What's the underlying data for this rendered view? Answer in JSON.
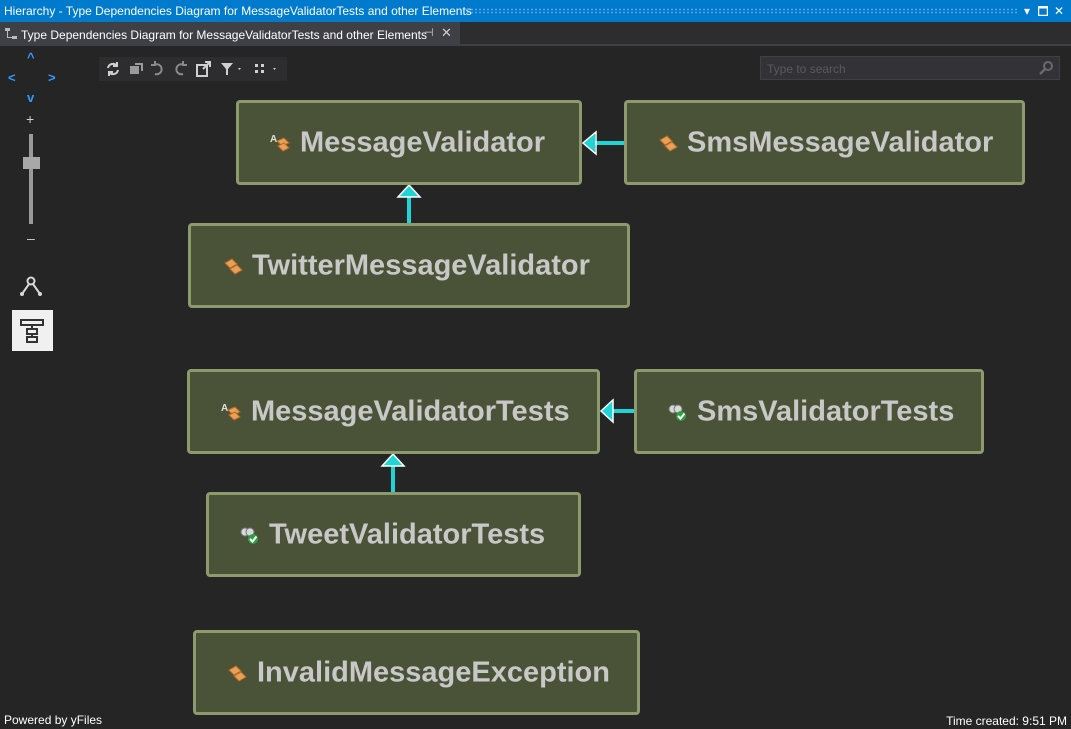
{
  "window": {
    "title": "Hierarchy - Type Dependencies Diagram for MessageValidatorTests and other Elements"
  },
  "tab": {
    "label": "Type Dependencies Diagram for MessageValidatorTests and other Elements"
  },
  "search": {
    "placeholder": "Type to search"
  },
  "nodes": {
    "message_validator": {
      "label": "MessageValidator",
      "kind": "abstract-class"
    },
    "sms_message_validator": {
      "label": "SmsMessageValidator",
      "kind": "class"
    },
    "twitter_message_validator": {
      "label": "TwitterMessageValidator",
      "kind": "class"
    },
    "message_validator_tests": {
      "label": "MessageValidatorTests",
      "kind": "abstract-class"
    },
    "sms_validator_tests": {
      "label": "SmsValidatorTests",
      "kind": "test-class"
    },
    "tweet_validator_tests": {
      "label": "TweetValidatorTests",
      "kind": "test-class"
    },
    "invalid_message_exception": {
      "label": "InvalidMessageException",
      "kind": "class"
    }
  },
  "edges": [
    {
      "from": "SmsMessageValidator",
      "to": "MessageValidator"
    },
    {
      "from": "TwitterMessageValidator",
      "to": "MessageValidator"
    },
    {
      "from": "SmsValidatorTests",
      "to": "MessageValidatorTests"
    },
    {
      "from": "TweetValidatorTests",
      "to": "MessageValidatorTests"
    }
  ],
  "footer": {
    "powered_by": "Powered by yFiles",
    "time_created": "Time created: 9:51 PM"
  },
  "colors": {
    "accent": "#007acc",
    "node_fill": "#4a5337",
    "node_border": "#8c9a6d",
    "edge": "#1fd4d4"
  },
  "icons": [
    "refresh-icon",
    "stop-icon",
    "undo-icon",
    "redo-icon",
    "export-icon",
    "filter-icon",
    "layout-dropdown-icon",
    "search-icon",
    "hierarchy-layout-icon",
    "tree-layout-icon",
    "pin-icon",
    "close-icon"
  ]
}
